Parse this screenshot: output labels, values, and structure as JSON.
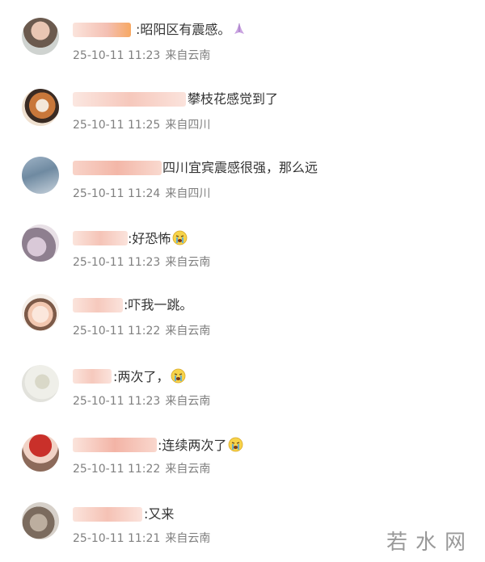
{
  "comments": [
    {
      "text": ":昭阳区有震感。",
      "emoji": "praying-hands-icon",
      "time": "25-10-11 11:23",
      "location": "来自云南"
    },
    {
      "text": "攀枝花感觉到了",
      "emoji": "",
      "time": "25-10-11 11:25",
      "location": "来自四川"
    },
    {
      "text": "四川宜宾震感很强，那么远",
      "emoji": "",
      "time": "25-10-11 11:24",
      "location": "来自四川"
    },
    {
      "text": ":好恐怖",
      "emoji": "crying-face-icon",
      "time": "25-10-11 11:23",
      "location": "来自云南"
    },
    {
      "text": ":吓我一跳。",
      "emoji": "",
      "time": "25-10-11 11:22",
      "location": "来自云南"
    },
    {
      "text": ":两次了，",
      "emoji": "crying-face-icon",
      "time": "25-10-11 11:23",
      "location": "来自云南"
    },
    {
      "text": ":连续两次了",
      "emoji": "crying-face-icon",
      "time": "25-10-11 11:22",
      "location": "来自云南"
    },
    {
      "text": ":又来",
      "emoji": "",
      "time": "25-10-11 11:21",
      "location": "来自云南"
    }
  ],
  "watermark": "若水网",
  "colors": {
    "comment_text": "#333333",
    "meta_text": "#808080",
    "blur_pink": "#f6c9bd",
    "blur_light": "#fbe3dc"
  }
}
